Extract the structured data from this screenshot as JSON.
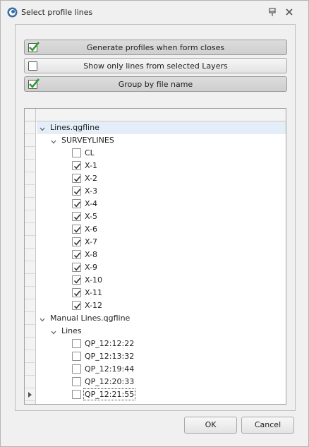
{
  "window": {
    "title": "Select profile lines"
  },
  "options": [
    {
      "label": "Generate profiles when form closes",
      "checked": true
    },
    {
      "label": "Show only lines from selected Layers",
      "checked": false
    },
    {
      "label": "Group by file name",
      "checked": true
    }
  ],
  "tree": {
    "rows": [
      {
        "level": 0,
        "kind": "group",
        "label": "Lines.qgfline",
        "expanded": true,
        "selected": true
      },
      {
        "level": 1,
        "kind": "group",
        "label": "SURVEYLINES",
        "expanded": true
      },
      {
        "level": 2,
        "kind": "item",
        "label": "CL",
        "checked": false
      },
      {
        "level": 2,
        "kind": "item",
        "label": "X-1",
        "checked": true
      },
      {
        "level": 2,
        "kind": "item",
        "label": "X-2",
        "checked": true
      },
      {
        "level": 2,
        "kind": "item",
        "label": "X-3",
        "checked": true
      },
      {
        "level": 2,
        "kind": "item",
        "label": "X-4",
        "checked": true
      },
      {
        "level": 2,
        "kind": "item",
        "label": "X-5",
        "checked": true
      },
      {
        "level": 2,
        "kind": "item",
        "label": "X-6",
        "checked": true
      },
      {
        "level": 2,
        "kind": "item",
        "label": "X-7",
        "checked": true
      },
      {
        "level": 2,
        "kind": "item",
        "label": "X-8",
        "checked": true
      },
      {
        "level": 2,
        "kind": "item",
        "label": "X-9",
        "checked": true
      },
      {
        "level": 2,
        "kind": "item",
        "label": "X-10",
        "checked": true
      },
      {
        "level": 2,
        "kind": "item",
        "label": "X-11",
        "checked": true
      },
      {
        "level": 2,
        "kind": "item",
        "label": "X-12",
        "checked": true
      },
      {
        "level": 0,
        "kind": "group",
        "label": "Manual Lines.qgfline",
        "expanded": true
      },
      {
        "level": 1,
        "kind": "group",
        "label": "Lines",
        "expanded": true
      },
      {
        "level": 2,
        "kind": "item",
        "label": "QP_12:12:22",
        "checked": false
      },
      {
        "level": 2,
        "kind": "item",
        "label": "QP_12:13:32",
        "checked": false
      },
      {
        "level": 2,
        "kind": "item",
        "label": "QP_12:19:44",
        "checked": false
      },
      {
        "level": 2,
        "kind": "item",
        "label": "QP_12:20:33",
        "checked": false
      },
      {
        "level": 2,
        "kind": "item",
        "label": "QP_12:21:55",
        "checked": false,
        "current": true
      }
    ]
  },
  "footer": {
    "ok_label": "OK",
    "cancel_label": "Cancel"
  },
  "colors": {
    "check_green": "#2f9e2f",
    "selection": "#e3eef8"
  }
}
